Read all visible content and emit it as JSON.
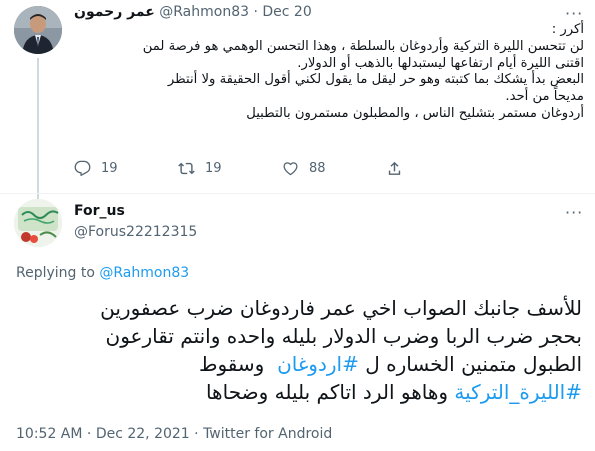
{
  "parent_tweet": {
    "author_name": "عمر رحمون",
    "handle": "@Rahmon83",
    "separator": "·",
    "date": "Dec 20",
    "lines": [
      "أكرر :",
      "لن تتحسن الليرة التركية وأردوغان بالسلطة ، وهذا التحسن الوهمي هو فرصة لمن",
      "اقتنى الليرة أيام ارتفاعها ليستبدلها بالذهب أو الدولار.",
      "البعض بدأ يشكك بما كتبته وهو حر ليقل ما يقول لكني أقول الحقيقة ولا أنتظر",
      "مديحاً من أحد.",
      "أردوغان مستمر بتشليح الناس ، والمطبلون مستمرون بالتطبيل"
    ],
    "replies": "19",
    "retweets": "19",
    "likes": "88"
  },
  "tweet": {
    "author_name": "For_us",
    "handle": "@Forus22212315",
    "replying_prefix": "Replying to",
    "replying_to": "@Rahmon83",
    "line1": "للأسف جانبك الصواب اخي عمر فاردوغان ضرب عصفورين",
    "line2": "بحجر ضرب الربا وضرب الدولار بليله واحده وانتم تقارعون",
    "line3_text": "الطبول متمنين الخساره ل",
    "line3_hashtag": "#اردوغان",
    "line3_suffix": "وسقوط",
    "line4_hashtag": "#الليرة_التركية",
    "line4_text": "وهاهو الرد اتاكم بليله وضحاها",
    "time": "10:52 AM",
    "separator": "·",
    "date": "Dec 22, 2021",
    "source": "Twitter for Android"
  },
  "icons": {
    "more": "more-dots-icon",
    "reply": "reply-bubble-icon",
    "retweet": "retweet-icon",
    "like": "heart-icon",
    "share": "share-icon"
  },
  "colors": {
    "link": "#1d9bf0",
    "secondary_text": "#536471",
    "primary_text": "#0f1419"
  }
}
